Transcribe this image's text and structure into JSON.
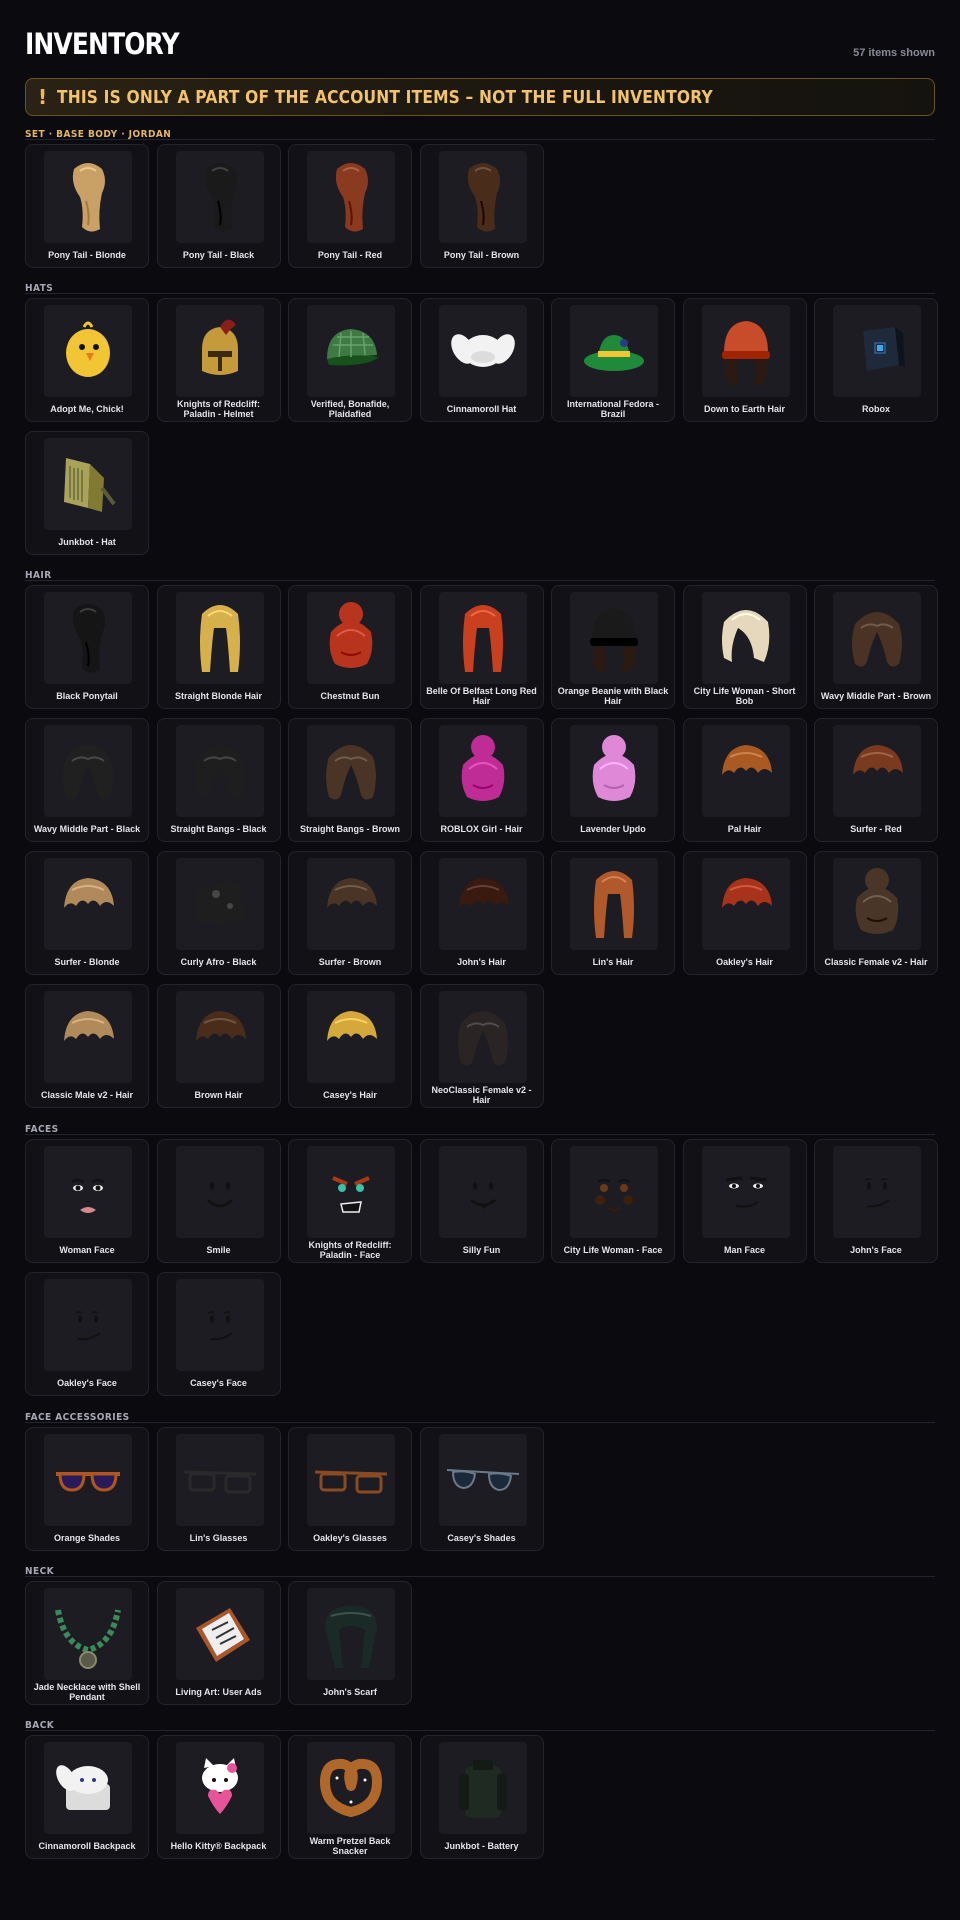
{
  "header": {
    "title": "INVENTORY",
    "count": "57 items shown"
  },
  "banner": {
    "icon": "!",
    "text": "THIS IS ONLY A PART OF THE ACCOUNT ITEMS – NOT THE FULL INVENTORY",
    "icon_name": "exclamation-icon"
  },
  "colors": {
    "background": "#0a0a0f",
    "card": "#111116",
    "accent_gold": "#f2c36a"
  },
  "sections": [
    {
      "key": "set",
      "title": "SET · BASE BODY · JORDAN",
      "items": [
        {
          "label": "Pony Tail - Blonde",
          "icon": "ponytail",
          "color": "#c9a065"
        },
        {
          "label": "Pony Tail - Black",
          "icon": "ponytail",
          "color": "#1a1a1a"
        },
        {
          "label": "Pony Tail - Red",
          "icon": "ponytail",
          "color": "#8a3a1e"
        },
        {
          "label": "Pony Tail - Brown",
          "icon": "ponytail",
          "color": "#4a2c1a"
        }
      ]
    },
    {
      "key": "hats",
      "title": "HATS",
      "items": [
        {
          "label": "Adopt Me, Chick!",
          "icon": "chick",
          "color": "#f2c534"
        },
        {
          "label": "Knights of Redcliff: Paladin - Helmet",
          "icon": "helmet",
          "color": "#8a1f1a"
        },
        {
          "label": "Verified, Bonafide, Plaidafied",
          "icon": "cap",
          "color": "#3f7a45"
        },
        {
          "label": "Cinnamoroll Hat",
          "icon": "bunny",
          "color": "#f2f2f2"
        },
        {
          "label": "International Fedora - Brazil",
          "icon": "fedora",
          "color": "#1f8a3a"
        },
        {
          "label": "Down to Earth Hair",
          "icon": "beanie",
          "color": "#c84b2a"
        },
        {
          "label": "Robox",
          "icon": "box",
          "color": "#1e2a3a"
        },
        {
          "label": "Junkbot - Hat",
          "icon": "junkhat",
          "color": "#a8a25a"
        }
      ]
    },
    {
      "key": "hair",
      "title": "HAIR",
      "items": [
        {
          "label": "Black Ponytail",
          "icon": "ponytail",
          "color": "#151515"
        },
        {
          "label": "Straight Blonde Hair",
          "icon": "long",
          "color": "#d6b04a"
        },
        {
          "label": "Chestnut Bun",
          "icon": "bun",
          "color": "#b8341c"
        },
        {
          "label": "Belle Of Belfast Long Red Hair",
          "icon": "long",
          "color": "#c8401e"
        },
        {
          "label": "Orange Beanie with Black Hair",
          "icon": "beanie",
          "color": "#1a1a1a"
        },
        {
          "label": "City Life Woman - Short Bob",
          "icon": "bob",
          "color": "#e6d8bc"
        },
        {
          "label": "Wavy Middle Part - Brown",
          "icon": "wavy",
          "color": "#4a3224"
        },
        {
          "label": "Wavy Middle Part - Black",
          "icon": "wavy",
          "color": "#202020"
        },
        {
          "label": "Straight Bangs - Black",
          "icon": "wavy",
          "color": "#1e1e1e"
        },
        {
          "label": "Straight Bangs - Brown",
          "icon": "wavy",
          "color": "#4a3426"
        },
        {
          "label": "ROBLOX Girl - Hair",
          "icon": "bun",
          "color": "#c02c96"
        },
        {
          "label": "Lavender Updo",
          "icon": "bun",
          "color": "#e088d8"
        },
        {
          "label": "Pal Hair",
          "icon": "short",
          "color": "#a85a22"
        },
        {
          "label": "Surfer - Red",
          "icon": "short",
          "color": "#7a3a20"
        },
        {
          "label": "Surfer - Blonde",
          "icon": "short",
          "color": "#b08a5a"
        },
        {
          "label": "Curly Afro - Black",
          "icon": "afro",
          "color": "#1e1e1e"
        },
        {
          "label": "Surfer - Brown",
          "icon": "short",
          "color": "#4a3426"
        },
        {
          "label": "John's Hair",
          "icon": "short",
          "color": "#3a1a0e"
        },
        {
          "label": "Lin's Hair",
          "icon": "long",
          "color": "#b05a2c"
        },
        {
          "label": "Oakley's Hair",
          "icon": "short",
          "color": "#a8321a"
        },
        {
          "label": "Classic Female v2 - Hair",
          "icon": "bun",
          "color": "#4a3628"
        },
        {
          "label": "Classic Male v2 - Hair",
          "icon": "short",
          "color": "#b08a5a"
        },
        {
          "label": "Brown Hair",
          "icon": "short",
          "color": "#4a2c1a"
        },
        {
          "label": "Casey's Hair",
          "icon": "short",
          "color": "#d4a83a"
        },
        {
          "label": "NeoClassic Female v2 - Hair",
          "icon": "wavy",
          "color": "#2a2424"
        }
      ]
    },
    {
      "key": "faces",
      "title": "FACES",
      "items": [
        {
          "label": "Woman Face",
          "icon": "face-woman",
          "color": "#000000"
        },
        {
          "label": "Smile",
          "icon": "face-smile",
          "color": "#000000"
        },
        {
          "label": "Knights of Redcliff: Paladin - Face",
          "icon": "face-angry",
          "color": "#000000"
        },
        {
          "label": "Silly Fun",
          "icon": "face-silly",
          "color": "#000000"
        },
        {
          "label": "City Life Woman - Face",
          "icon": "face-city",
          "color": "#000000"
        },
        {
          "label": "Man Face",
          "icon": "face-man",
          "color": "#000000"
        },
        {
          "label": "John's Face",
          "icon": "face-smirk",
          "color": "#000000"
        },
        {
          "label": "Oakley's Face",
          "icon": "face-smirk",
          "color": "#000000"
        },
        {
          "label": "Casey's Face",
          "icon": "face-smirk",
          "color": "#000000"
        }
      ]
    },
    {
      "key": "face-accessories",
      "title": "FACE ACCESSORIES",
      "items": [
        {
          "label": "Orange Shades",
          "icon": "shades",
          "color": "#b0561e"
        },
        {
          "label": "Lin's Glasses",
          "icon": "glasses",
          "color": "#2a2a2a"
        },
        {
          "label": "Oakley's Glasses",
          "icon": "glasses",
          "color": "#8a4a22"
        },
        {
          "label": "Casey's Shades",
          "icon": "aviator",
          "color": "#6a7a8a"
        }
      ]
    },
    {
      "key": "neck",
      "title": "NECK",
      "items": [
        {
          "label": "Jade Necklace with Shell Pendant",
          "icon": "necklace",
          "color": "#3a8a5a"
        },
        {
          "label": "Living Art: User Ads",
          "icon": "frame",
          "color": "#a8562a"
        },
        {
          "label": "John's Scarf",
          "icon": "scarf",
          "color": "#1a2a26"
        }
      ]
    },
    {
      "key": "back",
      "title": "BACK",
      "items": [
        {
          "label": "Cinnamoroll Backpack",
          "icon": "bunny-pack",
          "color": "#f2f2f2"
        },
        {
          "label": "Hello Kitty® Backpack",
          "icon": "kitty-pack",
          "color": "#e8549a"
        },
        {
          "label": "Warm Pretzel Back Snacker",
          "icon": "pretzel",
          "color": "#b0682a"
        },
        {
          "label": "Junkbot - Battery",
          "icon": "battery",
          "color": "#1e2a22"
        }
      ]
    }
  ]
}
